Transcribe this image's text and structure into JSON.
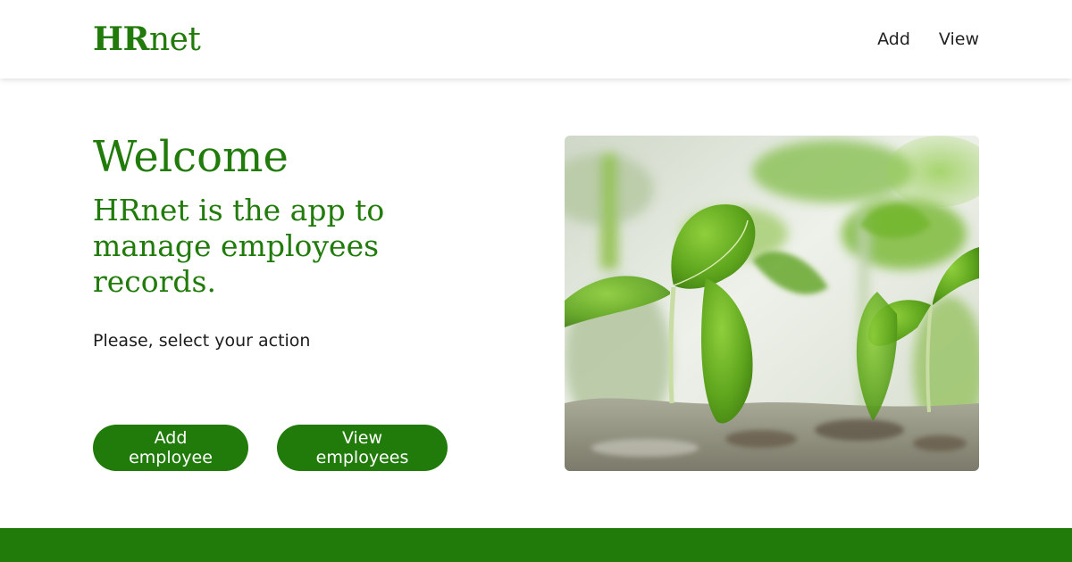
{
  "header": {
    "logo_bold": "HR",
    "logo_light": "net",
    "nav": [
      {
        "label": "Add"
      },
      {
        "label": "View"
      }
    ]
  },
  "main": {
    "welcome": "Welcome",
    "tagline": "HRnet is the app to manage employees records.",
    "prompt": "Please, select your action",
    "add_button": "Add employee",
    "view_button": "View employees"
  },
  "hero_image": {
    "icon": "plant-seedlings-photo"
  },
  "colors": {
    "brand": "#217b0a",
    "text": "#1c1c1c",
    "background": "#ffffff"
  }
}
